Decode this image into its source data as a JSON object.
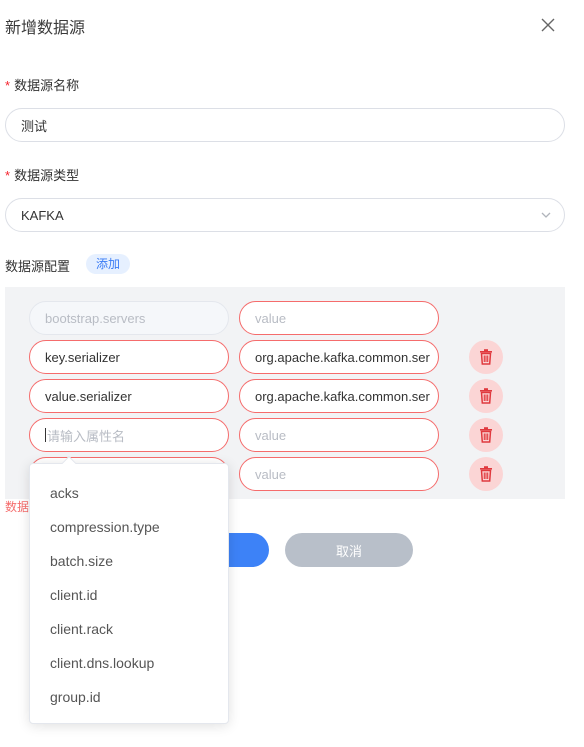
{
  "dialog": {
    "title": "新增数据源"
  },
  "form": {
    "name": {
      "label": "数据源名称",
      "value": "测试"
    },
    "type": {
      "label": "数据源类型",
      "value": "KAFKA"
    },
    "config": {
      "label": "数据源配置",
      "add_label": "添加",
      "rows": [
        {
          "key": "bootstrap.servers",
          "value": "value"
        },
        {
          "key": "key.serializer",
          "value": "org.apache.kafka.common.ser"
        },
        {
          "key": "value.serializer",
          "value": "org.apache.kafka.common.ser"
        },
        {
          "key": "请输入属性名",
          "value": "value"
        },
        {
          "key": "",
          "value": "value"
        }
      ]
    },
    "error_text": "数据"
  },
  "footer": {
    "cancel_label": "取消"
  },
  "dropdown": {
    "options": [
      "acks",
      "compression.type",
      "batch.size",
      "client.id",
      "client.rack",
      "client.dns.lookup",
      "group.id"
    ]
  },
  "colors": {
    "accent": "#3d82f7",
    "error": "#f56c6c",
    "delete_bg": "#fbd5d5",
    "delete_icon": "#e0393e"
  }
}
